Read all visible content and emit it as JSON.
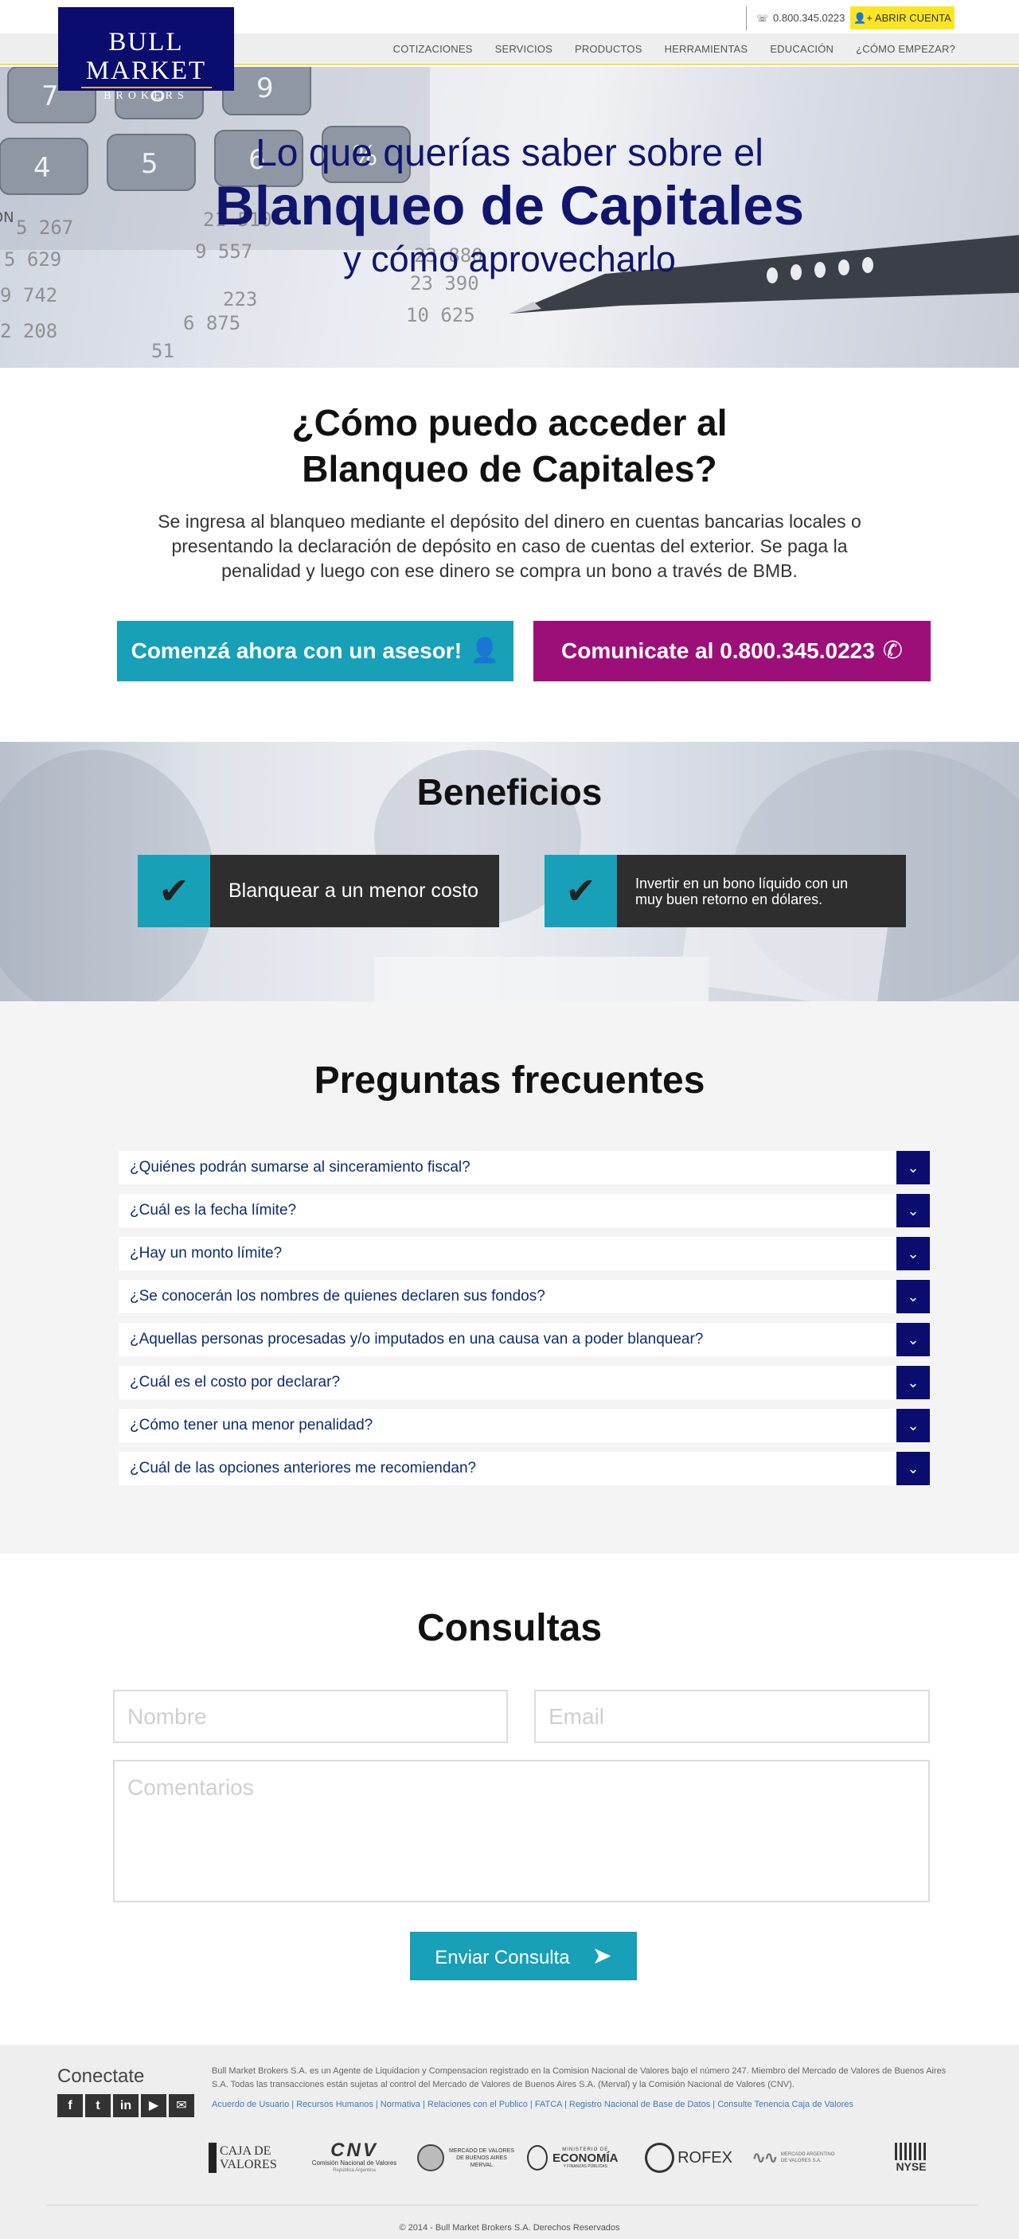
{
  "header": {
    "logo_line1": "BULL MARKET",
    "logo_line2": "BROKERS",
    "phone": "0.800.345.0223",
    "open_account": "ABRIR CUENTA",
    "nav": [
      "COTIZACIONES",
      "SERVICIOS",
      "PRODUCTOS",
      "HERRAMIENTAS",
      "EDUCACIÓN",
      "¿CÓMO EMPEZAR?"
    ]
  },
  "hero": {
    "line1": "Lo que querías saber sobre el",
    "line2": "Blanqueo de Capitales",
    "line3": "y cómo aprovecharlo",
    "keys": [
      "7",
      "8",
      "9",
      "4",
      "5",
      "6",
      "%",
      "ON"
    ],
    "ledger": [
      "5 267",
      "5 629",
      "9 742",
      "2 208",
      "21 510",
      "9 557",
      "6 875",
      "10 625",
      "23 390",
      "23 880",
      "223",
      "51"
    ]
  },
  "access": {
    "title_line1": "¿Cómo puedo acceder al",
    "title_line2": "Blanqueo de Capitales?",
    "text": "Se ingresa al blanqueo mediante el depósito del dinero en cuentas bancarias locales o presentando la declaración de depósito en caso de cuentas del exterior. Se paga la penalidad y luego con ese dinero se compra un bono a través de BMB.",
    "btn_asesor": "Comenzá ahora con un asesor!",
    "btn_llamar": "Comunicate al 0.800.345.0223"
  },
  "beneficios": {
    "title": "Beneficios",
    "items": [
      "Blanquear a un menor costo",
      "Invertir en un bono líquido con un muy buen retorno en dólares."
    ]
  },
  "faq": {
    "title": "Preguntas frecuentes",
    "items": [
      "¿Quiénes podrán sumarse al sinceramiento fiscal?",
      "¿Cuál es la fecha límite?",
      "¿Hay un monto límite?",
      "¿Se conocerán los nombres de quienes declaren sus fondos?",
      "¿Aquellas personas procesadas y/o imputados en una causa van a poder blanquear?",
      "¿Cuál es el costo por declarar?",
      "¿Cómo tener una menor penalidad?",
      "¿Cuál de las opciones anteriores me recomiendan?"
    ]
  },
  "contact": {
    "title": "Consultas",
    "name_placeholder": "Nombre",
    "email_placeholder": "Email",
    "comments_placeholder": "Comentarios",
    "submit": "Enviar Consulta"
  },
  "footer": {
    "connect": "Conectate",
    "socials": [
      "f",
      "t",
      "in",
      "▶",
      "✉"
    ],
    "legal": "Bull Market Brokers S.A. es un Agente de Liquidacion y Compensacion registrado en la Comision Nacional de Valores bajo el número 247. Miembro del Mercado de Valores de Buenos Aires S.A. Todas las transacciones están sujetas al control del Mercado de Valores de Buenos Aires S.A. (Merval) y la Comisión Nacional de Valores (CNV).",
    "links": [
      "Acuerdo de Usuario",
      "Recursos Humanos",
      "Normativa",
      "Relaciones con el Publico",
      "FATCA",
      "Registro Nacional de Base de Datos",
      "Consulte Tenencia Caja de Valores"
    ],
    "partners": {
      "caja_1": "CAJA DE",
      "caja_2": "VALORES",
      "cnv": "CNV",
      "cnv_sub": "Comisión Nacional de Valores",
      "cnv_sub2": "República Argentina",
      "merval_1": "MERCADO DE VALORES",
      "merval_2": "DE BUENOS AIRES",
      "merval_3": "MERVAL",
      "econ_1": "MINISTERIO DE",
      "econ_2": "ECONOMÍA",
      "econ_3": "Y FINANZAS PÚBLICAS",
      "rofex": "ROFEX",
      "mav_1": "MERCADO ARGENTINO",
      "mav_2": "DE VALORES S.A.",
      "nyse": "NYSE"
    },
    "copyright": "© 2014 - Bull Market Brokers S.A. Derechos Reservados"
  },
  "colors": {
    "navy": "#0b0d6e",
    "teal": "#17a0b8",
    "magenta": "#9d0f78",
    "yellow": "#fce525"
  }
}
